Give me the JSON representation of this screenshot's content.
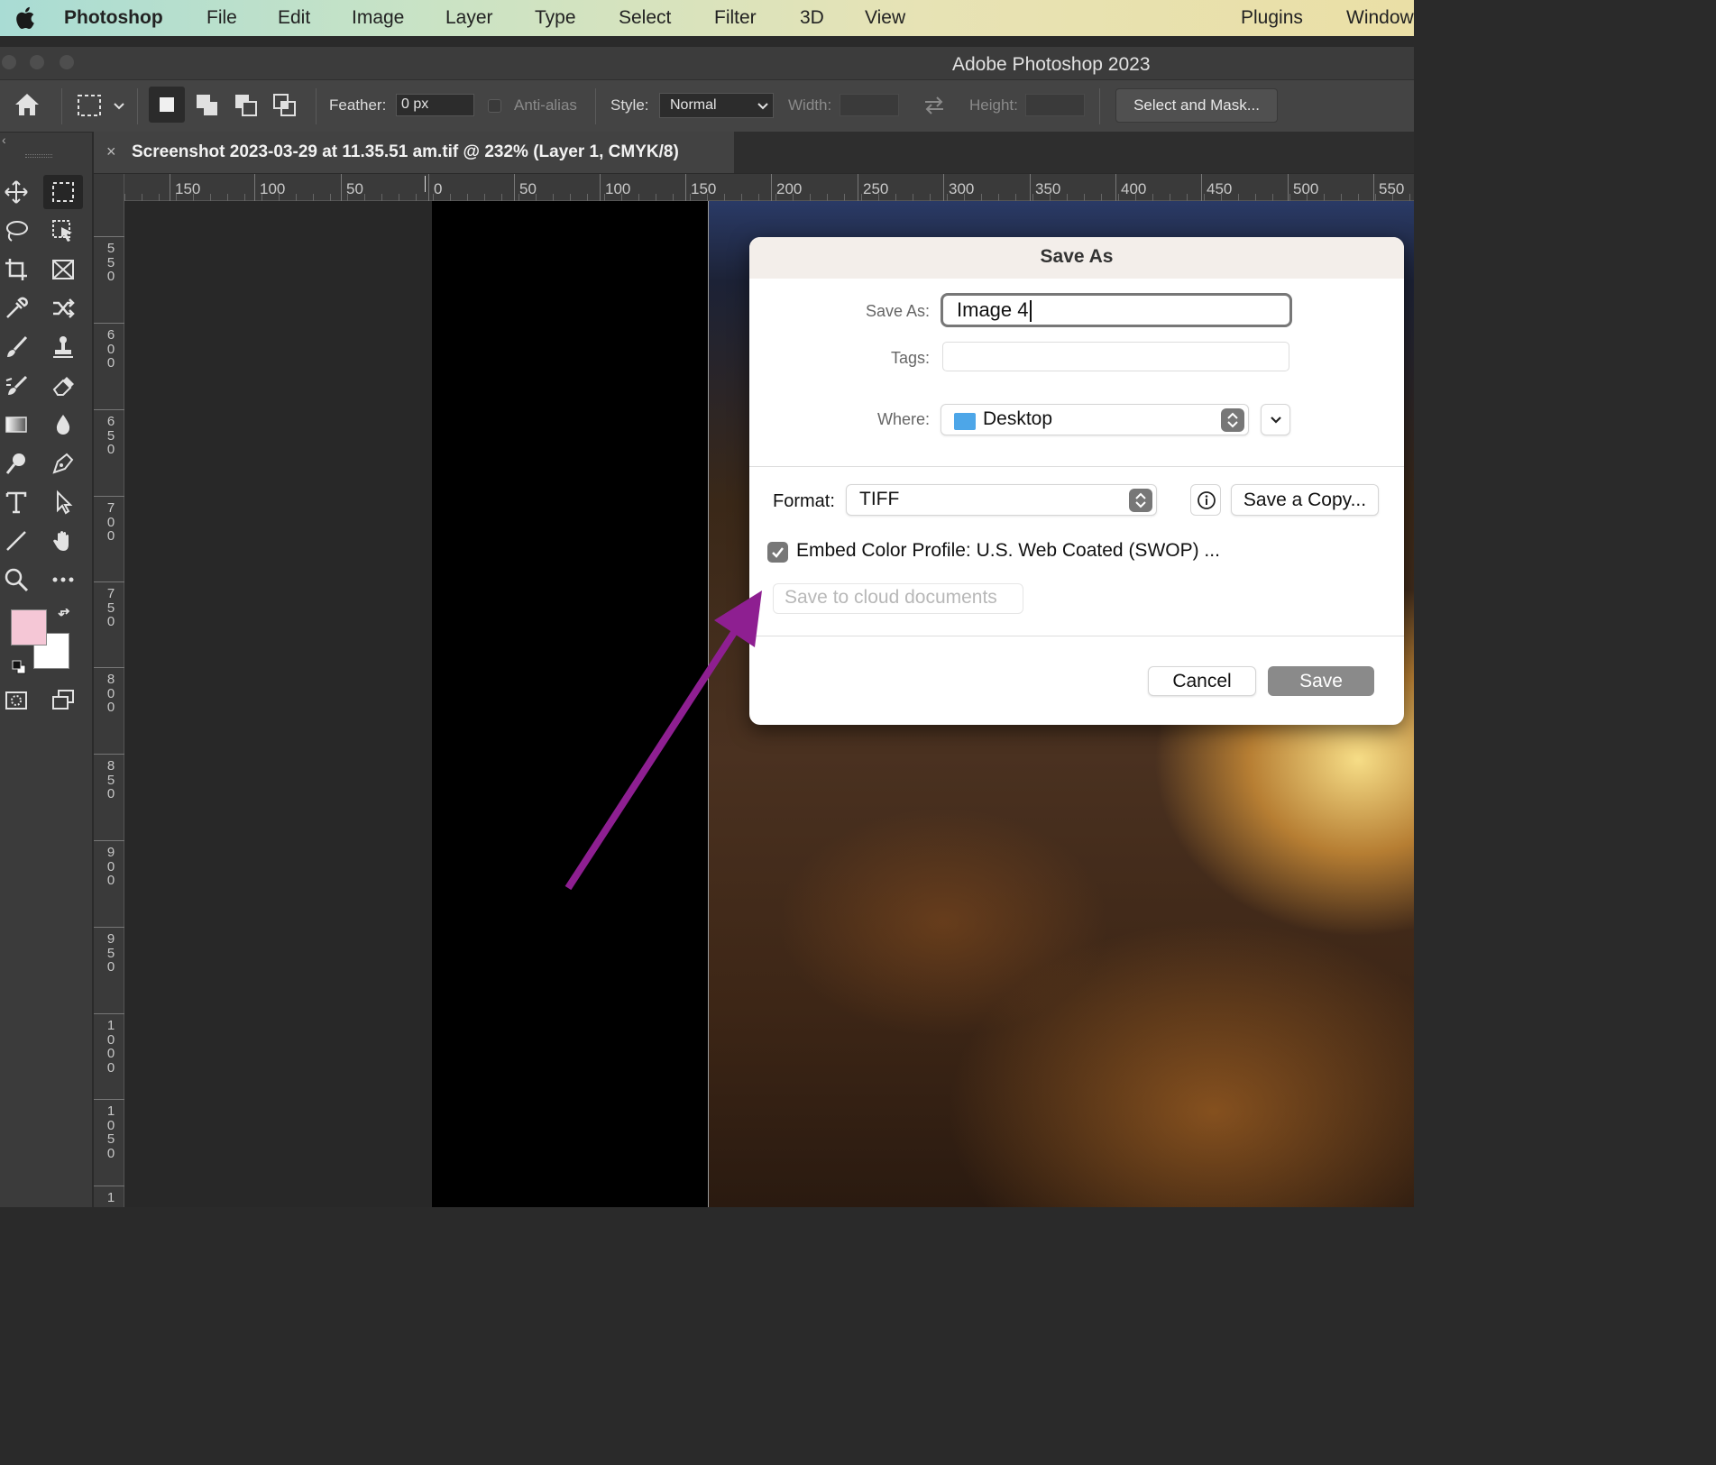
{
  "menubar": {
    "app_name": "Photoshop",
    "items": [
      "File",
      "Edit",
      "Image",
      "Layer",
      "Type",
      "Select",
      "Filter",
      "3D",
      "View",
      "Plugins",
      "Window"
    ]
  },
  "window": {
    "title": "Adobe Photoshop 2023"
  },
  "options": {
    "feather_label": "Feather:",
    "feather_value": "0 px",
    "antialias_label": "Anti-alias",
    "style_label": "Style:",
    "style_value": "Normal",
    "width_label": "Width:",
    "height_label": "Height:",
    "select_mask_label": "Select and Mask..."
  },
  "document": {
    "tab_title": "Screenshot 2023-03-29 at 11.35.51 am.tif @ 232% (Layer 1, CMYK/8)",
    "close_glyph": "×"
  },
  "rulers": {
    "horizontal": [
      "150",
      "100",
      "50",
      "0",
      "50",
      "100",
      "150",
      "200",
      "250",
      "300",
      "350",
      "400",
      "450",
      "500",
      "550"
    ],
    "vertical": [
      "550",
      "600",
      "650",
      "700",
      "750",
      "800",
      "850",
      "900",
      "950",
      "1000",
      "1050",
      "1"
    ]
  },
  "colors": {
    "foreground": "#f5c7d6",
    "background": "#ffffff",
    "arrow": "#8e1f91"
  },
  "dialog": {
    "title": "Save As",
    "save_as_label": "Save As:",
    "save_as_value": "Image 4",
    "tags_label": "Tags:",
    "where_label": "Where:",
    "where_value": "Desktop",
    "format_label": "Format:",
    "format_value": "TIFF",
    "save_copy_label": "Save a Copy...",
    "embed_label": "Embed Color Profile:  U.S. Web Coated (SWOP) ...",
    "embed_checked": true,
    "cloud_label": "Save to cloud documents",
    "cancel_label": "Cancel",
    "save_label": "Save"
  }
}
